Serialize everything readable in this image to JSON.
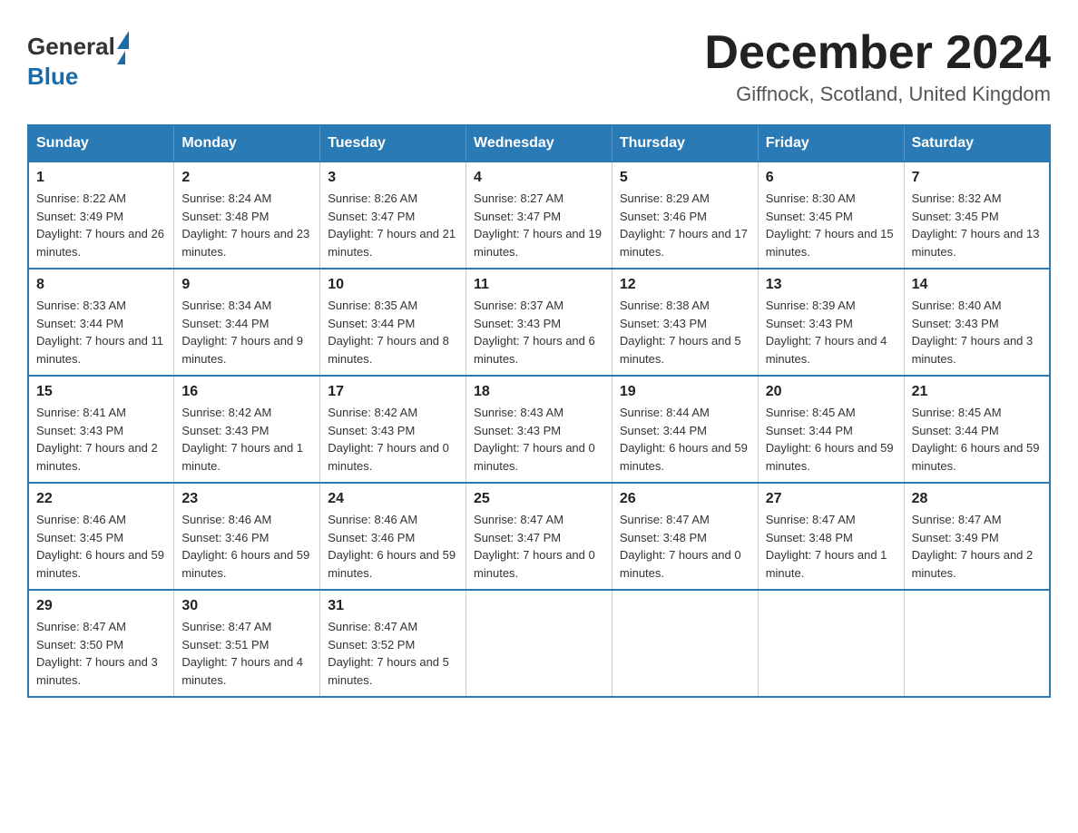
{
  "header": {
    "logo": {
      "general": "General",
      "blue": "Blue"
    },
    "title": "December 2024",
    "location": "Giffnock, Scotland, United Kingdom"
  },
  "calendar": {
    "days_of_week": [
      "Sunday",
      "Monday",
      "Tuesday",
      "Wednesday",
      "Thursday",
      "Friday",
      "Saturday"
    ],
    "weeks": [
      [
        {
          "day": "1",
          "sunrise": "Sunrise: 8:22 AM",
          "sunset": "Sunset: 3:49 PM",
          "daylight": "Daylight: 7 hours and 26 minutes."
        },
        {
          "day": "2",
          "sunrise": "Sunrise: 8:24 AM",
          "sunset": "Sunset: 3:48 PM",
          "daylight": "Daylight: 7 hours and 23 minutes."
        },
        {
          "day": "3",
          "sunrise": "Sunrise: 8:26 AM",
          "sunset": "Sunset: 3:47 PM",
          "daylight": "Daylight: 7 hours and 21 minutes."
        },
        {
          "day": "4",
          "sunrise": "Sunrise: 8:27 AM",
          "sunset": "Sunset: 3:47 PM",
          "daylight": "Daylight: 7 hours and 19 minutes."
        },
        {
          "day": "5",
          "sunrise": "Sunrise: 8:29 AM",
          "sunset": "Sunset: 3:46 PM",
          "daylight": "Daylight: 7 hours and 17 minutes."
        },
        {
          "day": "6",
          "sunrise": "Sunrise: 8:30 AM",
          "sunset": "Sunset: 3:45 PM",
          "daylight": "Daylight: 7 hours and 15 minutes."
        },
        {
          "day": "7",
          "sunrise": "Sunrise: 8:32 AM",
          "sunset": "Sunset: 3:45 PM",
          "daylight": "Daylight: 7 hours and 13 minutes."
        }
      ],
      [
        {
          "day": "8",
          "sunrise": "Sunrise: 8:33 AM",
          "sunset": "Sunset: 3:44 PM",
          "daylight": "Daylight: 7 hours and 11 minutes."
        },
        {
          "day": "9",
          "sunrise": "Sunrise: 8:34 AM",
          "sunset": "Sunset: 3:44 PM",
          "daylight": "Daylight: 7 hours and 9 minutes."
        },
        {
          "day": "10",
          "sunrise": "Sunrise: 8:35 AM",
          "sunset": "Sunset: 3:44 PM",
          "daylight": "Daylight: 7 hours and 8 minutes."
        },
        {
          "day": "11",
          "sunrise": "Sunrise: 8:37 AM",
          "sunset": "Sunset: 3:43 PM",
          "daylight": "Daylight: 7 hours and 6 minutes."
        },
        {
          "day": "12",
          "sunrise": "Sunrise: 8:38 AM",
          "sunset": "Sunset: 3:43 PM",
          "daylight": "Daylight: 7 hours and 5 minutes."
        },
        {
          "day": "13",
          "sunrise": "Sunrise: 8:39 AM",
          "sunset": "Sunset: 3:43 PM",
          "daylight": "Daylight: 7 hours and 4 minutes."
        },
        {
          "day": "14",
          "sunrise": "Sunrise: 8:40 AM",
          "sunset": "Sunset: 3:43 PM",
          "daylight": "Daylight: 7 hours and 3 minutes."
        }
      ],
      [
        {
          "day": "15",
          "sunrise": "Sunrise: 8:41 AM",
          "sunset": "Sunset: 3:43 PM",
          "daylight": "Daylight: 7 hours and 2 minutes."
        },
        {
          "day": "16",
          "sunrise": "Sunrise: 8:42 AM",
          "sunset": "Sunset: 3:43 PM",
          "daylight": "Daylight: 7 hours and 1 minute."
        },
        {
          "day": "17",
          "sunrise": "Sunrise: 8:42 AM",
          "sunset": "Sunset: 3:43 PM",
          "daylight": "Daylight: 7 hours and 0 minutes."
        },
        {
          "day": "18",
          "sunrise": "Sunrise: 8:43 AM",
          "sunset": "Sunset: 3:43 PM",
          "daylight": "Daylight: 7 hours and 0 minutes."
        },
        {
          "day": "19",
          "sunrise": "Sunrise: 8:44 AM",
          "sunset": "Sunset: 3:44 PM",
          "daylight": "Daylight: 6 hours and 59 minutes."
        },
        {
          "day": "20",
          "sunrise": "Sunrise: 8:45 AM",
          "sunset": "Sunset: 3:44 PM",
          "daylight": "Daylight: 6 hours and 59 minutes."
        },
        {
          "day": "21",
          "sunrise": "Sunrise: 8:45 AM",
          "sunset": "Sunset: 3:44 PM",
          "daylight": "Daylight: 6 hours and 59 minutes."
        }
      ],
      [
        {
          "day": "22",
          "sunrise": "Sunrise: 8:46 AM",
          "sunset": "Sunset: 3:45 PM",
          "daylight": "Daylight: 6 hours and 59 minutes."
        },
        {
          "day": "23",
          "sunrise": "Sunrise: 8:46 AM",
          "sunset": "Sunset: 3:46 PM",
          "daylight": "Daylight: 6 hours and 59 minutes."
        },
        {
          "day": "24",
          "sunrise": "Sunrise: 8:46 AM",
          "sunset": "Sunset: 3:46 PM",
          "daylight": "Daylight: 6 hours and 59 minutes."
        },
        {
          "day": "25",
          "sunrise": "Sunrise: 8:47 AM",
          "sunset": "Sunset: 3:47 PM",
          "daylight": "Daylight: 7 hours and 0 minutes."
        },
        {
          "day": "26",
          "sunrise": "Sunrise: 8:47 AM",
          "sunset": "Sunset: 3:48 PM",
          "daylight": "Daylight: 7 hours and 0 minutes."
        },
        {
          "day": "27",
          "sunrise": "Sunrise: 8:47 AM",
          "sunset": "Sunset: 3:48 PM",
          "daylight": "Daylight: 7 hours and 1 minute."
        },
        {
          "day": "28",
          "sunrise": "Sunrise: 8:47 AM",
          "sunset": "Sunset: 3:49 PM",
          "daylight": "Daylight: 7 hours and 2 minutes."
        }
      ],
      [
        {
          "day": "29",
          "sunrise": "Sunrise: 8:47 AM",
          "sunset": "Sunset: 3:50 PM",
          "daylight": "Daylight: 7 hours and 3 minutes."
        },
        {
          "day": "30",
          "sunrise": "Sunrise: 8:47 AM",
          "sunset": "Sunset: 3:51 PM",
          "daylight": "Daylight: 7 hours and 4 minutes."
        },
        {
          "day": "31",
          "sunrise": "Sunrise: 8:47 AM",
          "sunset": "Sunset: 3:52 PM",
          "daylight": "Daylight: 7 hours and 5 minutes."
        },
        null,
        null,
        null,
        null
      ]
    ]
  }
}
